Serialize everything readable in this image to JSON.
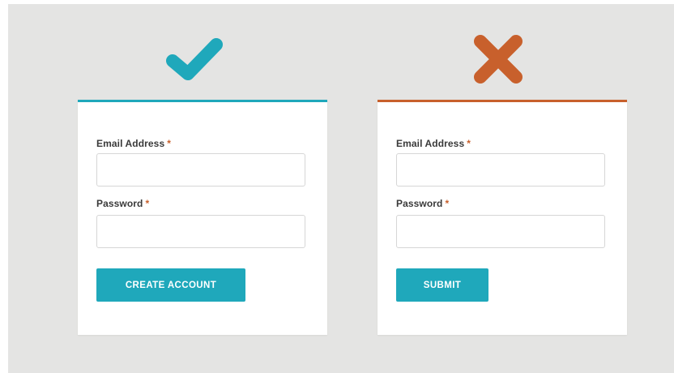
{
  "colors": {
    "good_accent": "#1fa8bb",
    "bad_accent": "#c8602c",
    "background": "#e4e4e3",
    "required_asterisk": "#c8602c"
  },
  "good_example": {
    "indicator_icon": "check-icon",
    "email_label": "Email Address",
    "email_value": "",
    "password_label": "Password",
    "password_value": "",
    "required_mark": "*",
    "button_label": "CREATE ACCOUNT"
  },
  "bad_example": {
    "indicator_icon": "cross-icon",
    "email_label": "Email Address",
    "email_value": "",
    "password_label": "Password",
    "password_value": "",
    "required_mark": "*",
    "button_label": "SUBMIT"
  }
}
